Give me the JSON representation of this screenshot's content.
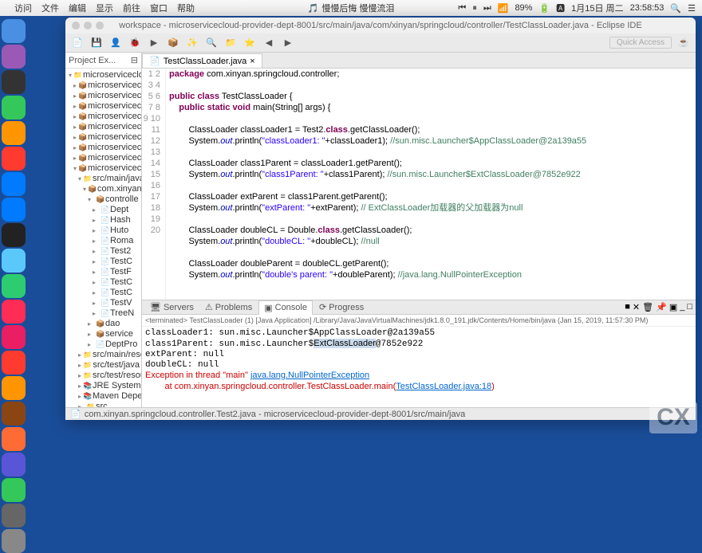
{
  "menubar": {
    "items": [
      "访问",
      "文件",
      "编辑",
      "显示",
      "前往",
      "窗口",
      "帮助"
    ],
    "center_title": "慢慢后悔 慢慢流泪",
    "battery": "89%",
    "date": "1月15日 周二",
    "time": "23:58:53"
  },
  "window": {
    "title": "workspace - microservicecloud-provider-dept-8001/src/main/java/com/xinyan/springcloud/controller/TestClassLoader.java - Eclipse IDE",
    "quick_access": "Quick Access"
  },
  "sidebar": {
    "title": "Project Ex...",
    "items": [
      {
        "indent": 0,
        "arrow": "▾",
        "icon": "📁",
        "label": "microservicecloud"
      },
      {
        "indent": 1,
        "arrow": "▸",
        "icon": "📦",
        "label": "microservicecloud"
      },
      {
        "indent": 1,
        "arrow": "▸",
        "icon": "📦",
        "label": "microservicecloud"
      },
      {
        "indent": 1,
        "arrow": "▸",
        "icon": "📦",
        "label": "microservicecloud"
      },
      {
        "indent": 1,
        "arrow": "▸",
        "icon": "📦",
        "label": "microservicecloud"
      },
      {
        "indent": 1,
        "arrow": "▸",
        "icon": "📦",
        "label": "microservicecloud"
      },
      {
        "indent": 1,
        "arrow": "▸",
        "icon": "📦",
        "label": "microservicecloud"
      },
      {
        "indent": 1,
        "arrow": "▸",
        "icon": "📦",
        "label": "microservicecloud"
      },
      {
        "indent": 1,
        "arrow": "▸",
        "icon": "📦",
        "label": "microservicecloud"
      },
      {
        "indent": 1,
        "arrow": "▾",
        "icon": "📦",
        "label": "microservicecloud"
      },
      {
        "indent": 2,
        "arrow": "▾",
        "icon": "📁",
        "label": "src/main/java"
      },
      {
        "indent": 3,
        "arrow": "▾",
        "icon": "📦",
        "label": "com.xinyan..."
      },
      {
        "indent": 4,
        "arrow": "▾",
        "icon": "📦",
        "label": "controlle"
      },
      {
        "indent": 5,
        "arrow": "▸",
        "icon": "📄",
        "label": "Dept"
      },
      {
        "indent": 5,
        "arrow": "▸",
        "icon": "📄",
        "label": "Hash"
      },
      {
        "indent": 5,
        "arrow": "▸",
        "icon": "📄",
        "label": "Huto"
      },
      {
        "indent": 5,
        "arrow": "▸",
        "icon": "📄",
        "label": "Roma"
      },
      {
        "indent": 5,
        "arrow": "▸",
        "icon": "📄",
        "label": "Test2"
      },
      {
        "indent": 5,
        "arrow": "▸",
        "icon": "📄",
        "label": "TestC"
      },
      {
        "indent": 5,
        "arrow": "▸",
        "icon": "📄",
        "label": "TestF"
      },
      {
        "indent": 5,
        "arrow": "▸",
        "icon": "📄",
        "label": "TestC"
      },
      {
        "indent": 5,
        "arrow": "▸",
        "icon": "📄",
        "label": "TestC"
      },
      {
        "indent": 5,
        "arrow": "▸",
        "icon": "📄",
        "label": "TestV"
      },
      {
        "indent": 5,
        "arrow": "▸",
        "icon": "📄",
        "label": "TreeN"
      },
      {
        "indent": 4,
        "arrow": "▸",
        "icon": "📦",
        "label": "dao"
      },
      {
        "indent": 4,
        "arrow": "▸",
        "icon": "📦",
        "label": "service"
      },
      {
        "indent": 4,
        "arrow": "▸",
        "icon": "📄",
        "label": "DeptPro"
      },
      {
        "indent": 2,
        "arrow": "▸",
        "icon": "📁",
        "label": "src/main/resou"
      },
      {
        "indent": 2,
        "arrow": "▸",
        "icon": "📁",
        "label": "src/test/java"
      },
      {
        "indent": 2,
        "arrow": "▸",
        "icon": "📁",
        "label": "src/test/resour"
      },
      {
        "indent": 2,
        "arrow": "▸",
        "icon": "📚",
        "label": "JRE System Lit"
      },
      {
        "indent": 2,
        "arrow": "▸",
        "icon": "📚",
        "label": "Maven Depend"
      },
      {
        "indent": 2,
        "arrow": "▸",
        "icon": "📁",
        "label": "src"
      }
    ]
  },
  "editor": {
    "tab": "TestClassLoader.java",
    "lines": [
      {
        "n": 1,
        "html": "<span class='kw'>package</span> com.xinyan.springcloud.controller;"
      },
      {
        "n": 2,
        "html": ""
      },
      {
        "n": 3,
        "html": "<span class='kw'>public class</span> TestClassLoader {"
      },
      {
        "n": 4,
        "html": "    <span class='kw'>public static void</span> main(String[] args) {"
      },
      {
        "n": 5,
        "html": ""
      },
      {
        "n": 6,
        "html": "        ClassLoader classLoader1 = Test2.<span class='kw'>class</span>.getClassLoader();"
      },
      {
        "n": 7,
        "html": "        System.<span class='field'>out</span>.println(<span class='str'>\"classLoader1: \"</span>+classLoader1); <span class='com'>//sun.misc.Launcher$AppClassLoader@2a139a55</span>"
      },
      {
        "n": 8,
        "html": ""
      },
      {
        "n": 9,
        "html": "        ClassLoader class1Parent = classLoader1.getParent();"
      },
      {
        "n": 10,
        "html": "        System.<span class='field'>out</span>.println(<span class='str'>\"class1Parent: \"</span>+class1Parent); <span class='com'>//sun.misc.Launcher$ExtClassLoader@7852e922</span>"
      },
      {
        "n": 11,
        "html": ""
      },
      {
        "n": 12,
        "html": "        ClassLoader extParent = class1Parent.getParent();"
      },
      {
        "n": 13,
        "html": "        System.<span class='field'>out</span>.println(<span class='str'>\"extParent: \"</span>+extParent); <span class='com'>// ExtClassLoader加载器的父加载器为null</span>"
      },
      {
        "n": 14,
        "html": ""
      },
      {
        "n": 15,
        "html": "        ClassLoader doubleCL = Double.<span class='kw'>class</span>.getClassLoader();"
      },
      {
        "n": 16,
        "html": "        System.<span class='field'>out</span>.println(<span class='str'>\"doubleCL: \"</span>+doubleCL); <span class='com'>//null</span>"
      },
      {
        "n": 17,
        "html": "",
        "hl": true
      },
      {
        "n": 18,
        "html": "        ClassLoader doubleParent = doubleCL.getParent();"
      },
      {
        "n": 19,
        "html": "        System.<span class='field'>out</span>.println(<span class='str'>\"double's parent: \"</span>+doubleParent); <span class='com'>//java.lang.NullPointerException</span>"
      },
      {
        "n": 20,
        "html": ""
      }
    ]
  },
  "console": {
    "tabs": [
      "Servers",
      "Problems",
      "Console",
      "Progress"
    ],
    "active": "Console",
    "info": "<terminated> TestClassLoader (1) [Java Application] /Library/Java/JavaVirtualMachines/jdk1.8.0_191.jdk/Contents/Home/bin/java (Jan 15, 2019, 11:57:30 PM)",
    "output_html": "classLoader1: sun.misc.Launcher$AppClassLoader@2a139a55\nclass1Parent: sun.misc.Launcher$<span class='hl'>ExtClassLoader</span>@7852e922\nextParent: null\ndoubleCL: null\n<span class='err'>Exception in thread \"main\" </span><span class='link'>java.lang.NullPointerException</span>\n<span class='err'>        at com.xinyan.springcloud.controller.TestClassLoader.main(</span><span class='link'>TestClassLoader.java:18</span><span class='err'>)</span>"
  },
  "statusbar": {
    "text": "com.xinyan.springcloud.controller.Test2.java - microservicecloud-provider-dept-8001/src/main/java"
  },
  "watermark": "CX",
  "dock_colors": [
    "#4a90e2",
    "#9b59b6",
    "#333",
    "#34c759",
    "#ff9500",
    "#ff3b30",
    "#007aff",
    "#007aff",
    "#222",
    "#5ac8fa",
    "#2ecc71",
    "#ff2d55",
    "#e91e63",
    "#ff3b30",
    "#ff9500",
    "#8b4513",
    "#ff6b35",
    "#5856d6",
    "#34c759",
    "#666",
    "#888"
  ]
}
